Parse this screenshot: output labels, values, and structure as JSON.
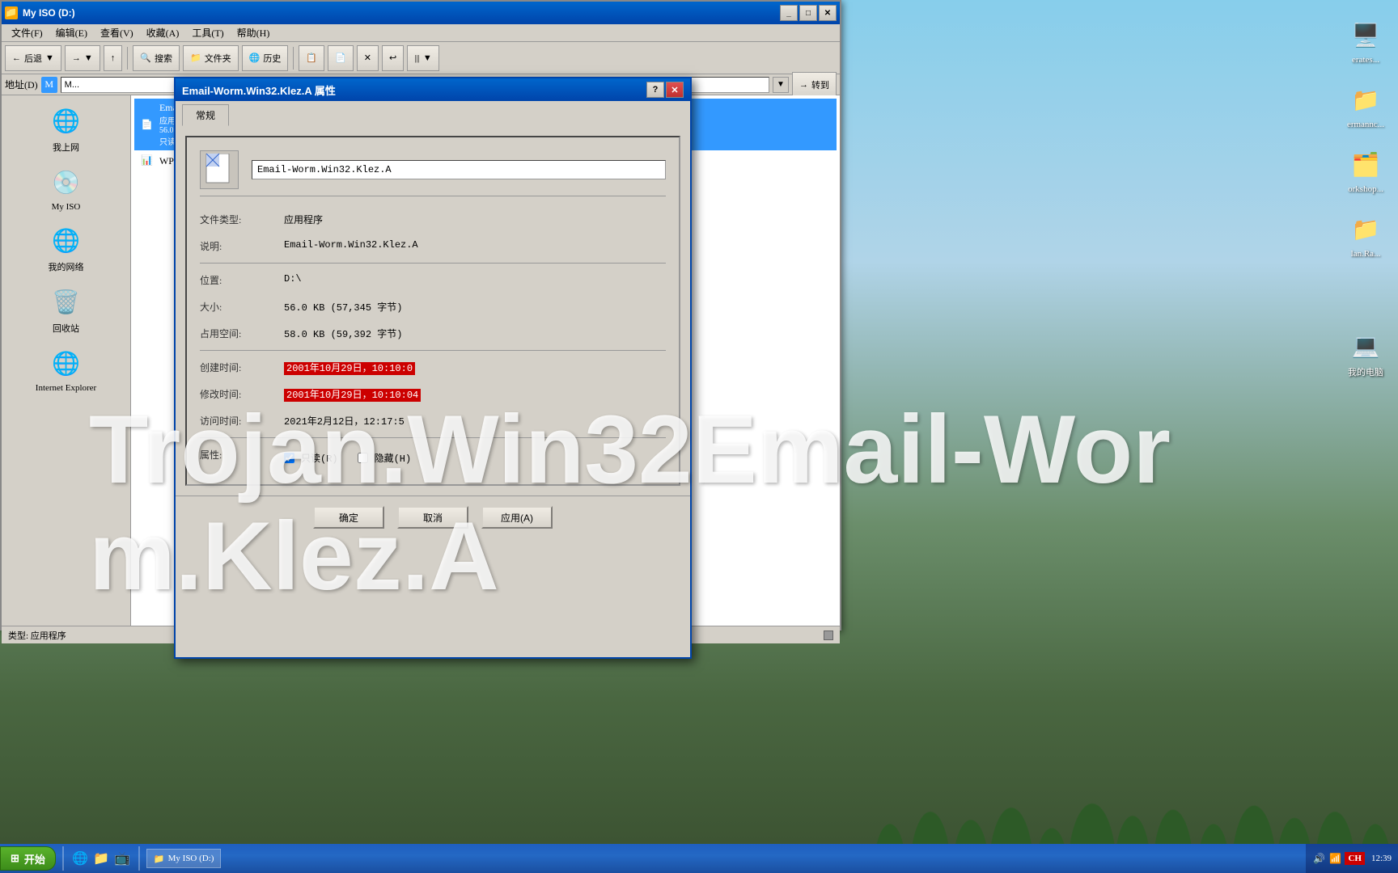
{
  "desktop": {
    "background": "winter scene with snow trees"
  },
  "explorer": {
    "title": "My ISO (D:)",
    "menubar": {
      "items": [
        "文件(F)",
        "编辑(E)",
        "查看(V)",
        "收藏(A)",
        "工具(T)",
        "帮助(H)"
      ]
    },
    "toolbar": {
      "back": "后退",
      "forward": "→",
      "up": "↑",
      "search": "搜索",
      "folders": "文件夹",
      "history": "历史",
      "views": "|||"
    },
    "addressbar": {
      "label": "地址(D)",
      "value": "M..."
    },
    "goto": "转到",
    "sidebar_items": [
      {
        "label": "我上网",
        "icon": "🌐"
      },
      {
        "label": "My ISO",
        "icon": "💿"
      },
      {
        "label": "我的网络",
        "icon": "🌐"
      },
      {
        "label": "回收站",
        "icon": "🗑️"
      },
      {
        "label": "Internet Explorer",
        "icon": "🌐"
      },
      {
        "label": "WPS表",
        "icon": "📊"
      }
    ],
    "selected_file": {
      "name": "Email-Worm.",
      "type": "应用程序",
      "modified": "200...",
      "size": "56.0 KB",
      "attributes": "只读"
    },
    "statusbar": {
      "type_label": "类型: 应用程序"
    }
  },
  "properties_dialog": {
    "title": "Email-Worm.Win32.Klez.A 属性",
    "tab": "常规",
    "file_name": "Email-Worm.Win32.Klez.A",
    "fields": {
      "file_type_label": "文件类型:",
      "file_type_value": "应用程序",
      "description_label": "说明:",
      "description_value": "Email-Worm.Win32.Klez.A",
      "location_label": "位置:",
      "location_value": "D:\\",
      "size_label": "大小:",
      "size_value": "56.0 KB (57,345 字节)",
      "disk_size_label": "占用空间:",
      "disk_size_value": "58.0 KB (59,392 字节)",
      "created_label": "创建时间:",
      "created_value": "2001年10月29日，10:10:0",
      "modified_label": "修改时间:",
      "modified_value": "2001年10月29日，10:10:04",
      "accessed_label": "访问时间:",
      "accessed_value": "2021年2月12日，12:17:5",
      "attributes_label": "属性:",
      "attributes_readonly": "只读(R)",
      "attributes_hidden": "隐藏(H)"
    },
    "buttons": {
      "ok": "确定",
      "cancel": "取消",
      "apply": "应用(A)"
    }
  },
  "watermark": {
    "line1": "Trojan.Win32Email-Wor",
    "line2": "m.Klez.A"
  },
  "taskbar": {
    "start": "开始",
    "items": [
      "My ISO (D:)"
    ],
    "tray_icons": [
      "🔊",
      "📶",
      "CH"
    ],
    "clock": "12:39"
  },
  "desktop_icons": [
    {
      "label": "erates...",
      "icon": "🖥️"
    },
    {
      "label": "ermannc...",
      "icon": "📁"
    },
    {
      "label": "orkshop...",
      "icon": "🗂️"
    },
    {
      "label": "lan.Ra...",
      "icon": "📁"
    },
    {
      "label": "我的电脑",
      "icon": "💻"
    }
  ]
}
